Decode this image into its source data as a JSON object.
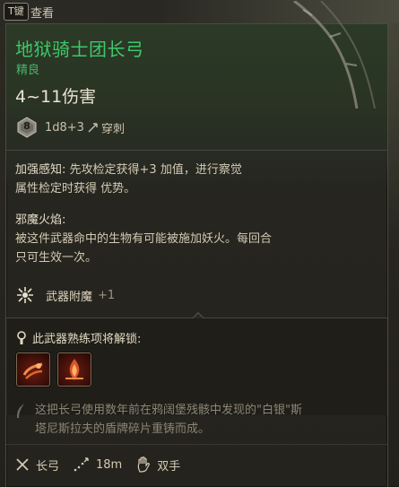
{
  "topbar": {
    "key_badge": "T键",
    "view_label": "查看"
  },
  "item": {
    "name": "地狱骑士团长弓",
    "rarity": "精良",
    "damage": "4~11伤害",
    "dice": {
      "die_label": "8",
      "formula": "1d8+3",
      "damage_type": "穿刺"
    },
    "colors": {
      "name": "#3ec86a",
      "rarity": "#46b56a"
    }
  },
  "passive1": {
    "name": "加强感知:",
    "text_line1": "先攻检定获得+3 加值，进行察觉",
    "text_line2": "属性检定时获得 优势。"
  },
  "passive2": {
    "name": "邪魔火焰:",
    "text_line1": "被这件武器命中的生物有可能被施加妖火。每回合",
    "text_line2": "只可生效一次。"
  },
  "enchant": {
    "label": "武器附魔",
    "value": "+1"
  },
  "mastery": {
    "title": "此武器熟练项将解锁:",
    "actions": [
      {
        "icon": "flame-slash-icon"
      },
      {
        "icon": "flame-shot-icon"
      }
    ]
  },
  "flavor": {
    "line1": "这把长弓使用数年前在鸦阔堡残骸中发现的\"白银\"斯",
    "line2": "塔尼斯拉夫的盾牌碎片重铸而成。"
  },
  "footer": {
    "weapon_type": "长弓",
    "range": "18m",
    "handedness": "双手"
  }
}
